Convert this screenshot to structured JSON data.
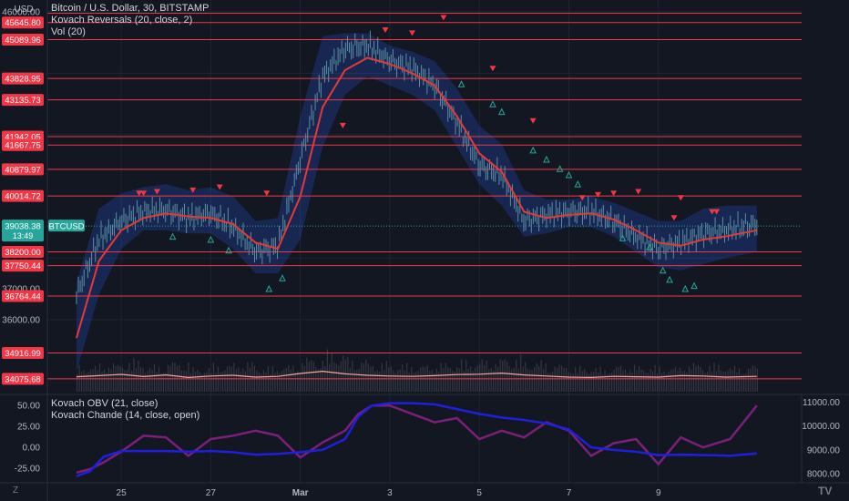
{
  "symbol_title": "Bitcoin / U.S. Dollar, 30, BITSTAMP",
  "indicator1": "Kovach Reversals (20, close, 2)",
  "indicator2": "Vol (20)",
  "indicator3": "Kovach OBV (21, close)",
  "indicator4": "Kovach Chande (14, close, open)",
  "currency": "USD",
  "tz_label": "Z",
  "logo_text": "TV",
  "colors": {
    "background": "#131722",
    "grid": "#1f2433",
    "level_line": "#f23645",
    "band_fill": "#2962ff",
    "candle": "#5b8fa3",
    "ma_line": "#e53935",
    "buy_marker": "#26a69a",
    "sell_marker": "#f23645",
    "current_price": "#26a69a",
    "volume_line": "#f8a5a0",
    "obv_line": "#1f1fe0",
    "chande_line": "#7b1f7a"
  },
  "chart_data": [
    {
      "type": "line",
      "name": "price",
      "x_ticks": [
        "25",
        "27",
        "Mar",
        "3",
        "5",
        "7",
        "9"
      ],
      "y_ticks": [
        "46000.00",
        "36000.00",
        "37000.00"
      ],
      "ylim": [
        33600,
        46200
      ],
      "level_lines": [
        {
          "label": "45645.80",
          "value": 45645.8
        },
        {
          "label": "45089.96",
          "value": 45089.96
        },
        {
          "label": "43828.95",
          "value": 43828.95
        },
        {
          "label": "43135.73",
          "value": 43135.73
        },
        {
          "label": "41942.05",
          "value": 41942.05
        },
        {
          "label": "41667.75",
          "value": 41667.75
        },
        {
          "label": "40879.97",
          "value": 40879.97
        },
        {
          "label": "40014.72",
          "value": 40014.72
        },
        {
          "label": "38200.00",
          "value": 38200.0
        },
        {
          "label": "37750.44",
          "value": 37750.44
        },
        {
          "label": "36764.44",
          "value": 36764.44
        },
        {
          "label": "34916.99",
          "value": 34916.99
        },
        {
          "label": "34075.68",
          "value": 34075.68
        }
      ],
      "top_line_value": 45950,
      "current_price": {
        "label": "39038.38",
        "sub": "13:49",
        "tag": "BTCUSD",
        "value": 39038.38
      },
      "x_days": [
        24.0,
        24.5,
        25.0,
        25.5,
        26.0,
        26.5,
        27.0,
        27.5,
        28.0,
        28.5,
        29.0,
        29.5,
        30.0,
        30.5,
        31.0,
        31.5,
        32.0,
        32.5,
        33.0,
        33.5,
        34.0,
        34.5,
        35.0,
        35.5,
        36.0,
        36.5,
        37.0,
        37.5,
        38.0,
        38.5,
        39.2
      ],
      "close": [
        36800,
        38600,
        39200,
        39500,
        39550,
        39300,
        39450,
        39000,
        38200,
        38400,
        41200,
        43900,
        44800,
        44900,
        44400,
        44150,
        43600,
        42400,
        41000,
        40700,
        39200,
        39400,
        39500,
        39500,
        39200,
        38700,
        38300,
        38500,
        38800,
        38900,
        39100
      ],
      "ma": [
        35400,
        37900,
        38900,
        39300,
        39450,
        39350,
        39300,
        39100,
        38500,
        38300,
        40000,
        42900,
        44100,
        44500,
        44300,
        44000,
        43600,
        42600,
        41400,
        40800,
        39500,
        39300,
        39400,
        39450,
        39250,
        38900,
        38500,
        38400,
        38600,
        38700,
        38900
      ],
      "band_upper": [
        37200,
        39600,
        40100,
        40300,
        40400,
        40200,
        40300,
        40000,
        39200,
        39300,
        42600,
        45200,
        45300,
        45300,
        44900,
        44700,
        44400,
        43500,
        42300,
        41700,
        40200,
        39900,
        39900,
        40000,
        39800,
        39500,
        39200,
        39200,
        39600,
        39700,
        39700
      ],
      "band_lower": [
        34300,
        36800,
        38300,
        38900,
        38900,
        38800,
        38800,
        38300,
        37500,
        37500,
        38600,
        41600,
        43300,
        43900,
        43600,
        43300,
        42800,
        41600,
        40400,
        39700,
        38700,
        38800,
        39000,
        39000,
        38700,
        38200,
        37700,
        37600,
        37800,
        38000,
        38200
      ],
      "sell_markers": [
        {
          "x": 25.4,
          "y": 40100
        },
        {
          "x": 25.5,
          "y": 40100
        },
        {
          "x": 25.8,
          "y": 40150
        },
        {
          "x": 26.6,
          "y": 40200
        },
        {
          "x": 27.2,
          "y": 40300
        },
        {
          "x": 28.25,
          "y": 40100
        },
        {
          "x": 29.95,
          "y": 42300
        },
        {
          "x": 30.9,
          "y": 45400
        },
        {
          "x": 31.5,
          "y": 45300
        },
        {
          "x": 32.2,
          "y": 45800
        },
        {
          "x": 33.3,
          "y": 44150
        },
        {
          "x": 34.2,
          "y": 42450
        },
        {
          "x": 35.3,
          "y": 39950
        },
        {
          "x": 35.65,
          "y": 40050
        },
        {
          "x": 36.0,
          "y": 40100
        },
        {
          "x": 36.55,
          "y": 40150
        },
        {
          "x": 37.35,
          "y": 39300
        },
        {
          "x": 37.5,
          "y": 39950
        },
        {
          "x": 38.2,
          "y": 39500
        },
        {
          "x": 38.3,
          "y": 39500
        }
      ],
      "buy_markers": [
        {
          "x": 26.15,
          "y": 38700
        },
        {
          "x": 27.0,
          "y": 38600
        },
        {
          "x": 27.4,
          "y": 38250
        },
        {
          "x": 28.3,
          "y": 37000
        },
        {
          "x": 28.6,
          "y": 37350
        },
        {
          "x": 32.6,
          "y": 43650
        },
        {
          "x": 33.3,
          "y": 43000
        },
        {
          "x": 33.5,
          "y": 42750
        },
        {
          "x": 34.2,
          "y": 41500
        },
        {
          "x": 34.5,
          "y": 41200
        },
        {
          "x": 34.8,
          "y": 40900
        },
        {
          "x": 35.0,
          "y": 40700
        },
        {
          "x": 35.2,
          "y": 40400
        },
        {
          "x": 36.2,
          "y": 38650
        },
        {
          "x": 36.8,
          "y": 38350
        },
        {
          "x": 37.1,
          "y": 37600
        },
        {
          "x": 37.25,
          "y": 37300
        },
        {
          "x": 37.6,
          "y": 37000
        },
        {
          "x": 37.8,
          "y": 37100
        }
      ],
      "volume_ma": [
        0.32,
        0.38,
        0.45,
        0.33,
        0.42,
        0.28,
        0.36,
        0.4,
        0.3,
        0.34,
        0.5,
        0.62,
        0.48,
        0.4,
        0.36,
        0.34,
        0.38,
        0.44,
        0.46,
        0.52,
        0.42,
        0.36,
        0.3,
        0.28,
        0.34,
        0.32,
        0.3,
        0.38,
        0.36,
        0.3,
        0.34
      ]
    },
    {
      "type": "line",
      "name": "oscillators",
      "y_ticks_left": [
        "50.00",
        "25.00",
        "0.00",
        "-25.00"
      ],
      "y_ticks_right": [
        "11000.00",
        "10000.00",
        "9000.00",
        "8000.00"
      ],
      "ylim_left": [
        -40,
        60
      ],
      "ylim_right": [
        7700,
        11200
      ],
      "x_days": [
        24.0,
        24.3,
        24.6,
        25.0,
        25.5,
        26.0,
        26.5,
        27.0,
        27.5,
        28.0,
        28.5,
        29.0,
        29.5,
        30.0,
        30.3,
        30.6,
        31.0,
        31.5,
        32.0,
        32.5,
        33.0,
        33.5,
        34.0,
        34.5,
        35.0,
        35.5,
        36.0,
        36.5,
        37.0,
        37.5,
        38.0,
        38.3,
        38.6,
        39.2
      ],
      "obv": [
        7900,
        8100,
        8700,
        8950,
        8950,
        8950,
        8920,
        8950,
        8900,
        8800,
        8830,
        8900,
        9000,
        9450,
        10400,
        10850,
        10950,
        10950,
        10900,
        10700,
        10500,
        10350,
        10250,
        10100,
        9850,
        9100,
        9000,
        8920,
        8780,
        8800,
        8780,
        8770,
        8750,
        8850
      ],
      "chande": [
        -30,
        -26,
        -18,
        -5,
        14,
        12,
        -10,
        10,
        14,
        20,
        14,
        -12,
        6,
        20,
        40,
        50,
        50,
        40,
        30,
        35,
        10,
        20,
        12,
        30,
        20,
        -10,
        5,
        10,
        -20,
        12,
        0,
        5,
        10,
        50,
        45
      ]
    }
  ]
}
